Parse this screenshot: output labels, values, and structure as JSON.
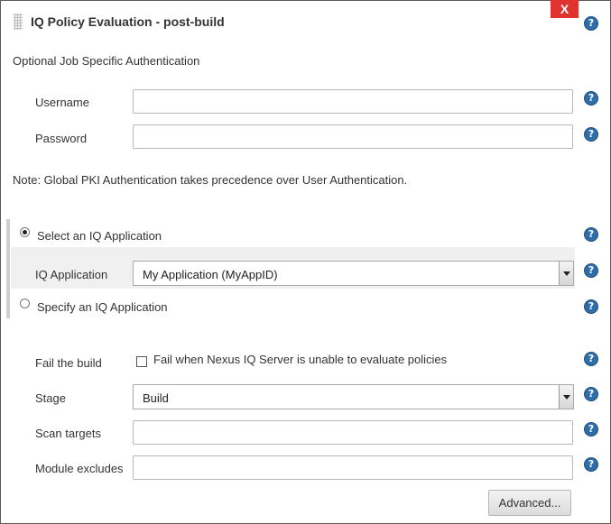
{
  "header": {
    "title": "IQ Policy Evaluation - post-build",
    "close_label": "X"
  },
  "auth": {
    "section_label": "Optional Job Specific Authentication",
    "username_label": "Username",
    "username_value": "",
    "password_label": "Password",
    "password_value": "",
    "note": "Note: Global PKI Authentication takes precedence over User Authentication."
  },
  "application": {
    "select_option_label": "Select an IQ Application",
    "select_option_checked": true,
    "app_label": "IQ Application",
    "app_value": "My Application (MyAppID)",
    "specify_option_label": "Specify an IQ Application",
    "specify_option_checked": false
  },
  "build": {
    "fail_label": "Fail the build",
    "fail_checkbox_label": "Fail when Nexus IQ Server is unable to evaluate policies",
    "fail_checked": false,
    "stage_label": "Stage",
    "stage_value": "Build",
    "scan_targets_label": "Scan targets",
    "scan_targets_value": "",
    "module_excludes_label": "Module excludes",
    "module_excludes_value": "",
    "advanced_label": "Advanced..."
  },
  "icons": {
    "help": "help-icon",
    "grip": "drag-handle-icon",
    "close": "close-icon"
  },
  "colors": {
    "close_bg": "#e0332f",
    "help_bg": "#2e6ea8"
  }
}
